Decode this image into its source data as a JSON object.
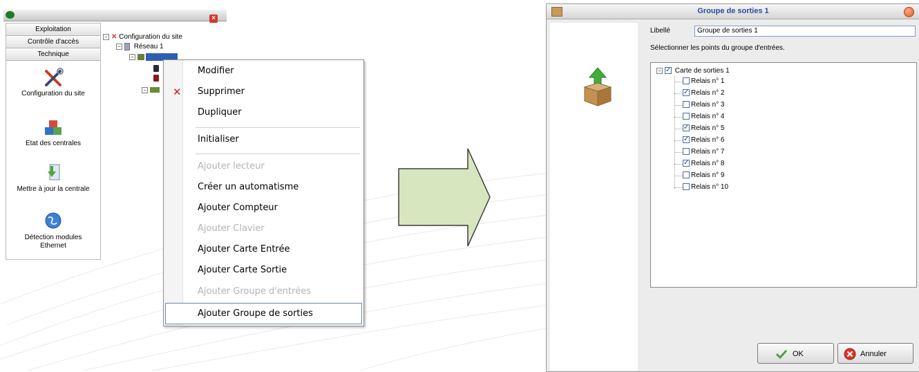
{
  "left_app": {
    "accordion": [
      "Exploitation",
      "Contrôle d'accès",
      "Technique"
    ],
    "sidebar_buttons": [
      {
        "label": "Configuration du site",
        "icon": "tools-icon"
      },
      {
        "label": "Etat des centrales",
        "icon": "blocks-icon"
      },
      {
        "label": "Mettre à jour la centrale",
        "icon": "update-icon"
      },
      {
        "label_line1": "Détection modules",
        "label_line2": "Ethernet",
        "icon": "globe-icon"
      }
    ],
    "tree": {
      "root": "Configuration du site",
      "network": "Réseau 1"
    }
  },
  "context_menu": {
    "items": [
      {
        "label": "Modifier",
        "enabled": true
      },
      {
        "label": "Supprimer",
        "enabled": true,
        "icon": "delete-icon"
      },
      {
        "label": "Dupliquer",
        "enabled": true
      },
      {
        "label": "Initialiser",
        "enabled": true
      },
      {
        "label": "Ajouter lecteur",
        "enabled": false
      },
      {
        "label": "Créer un automatisme",
        "enabled": true
      },
      {
        "label": "Ajouter Compteur",
        "enabled": true
      },
      {
        "label": "Ajouter Clavier",
        "enabled": false
      },
      {
        "label": "Ajouter Carte Entrée",
        "enabled": true
      },
      {
        "label": "Ajouter Carte Sortie",
        "enabled": true
      },
      {
        "label": "Ajouter Groupe d'entrées",
        "enabled": false
      },
      {
        "label": "Ajouter Groupe de sorties",
        "enabled": true,
        "highlighted": true
      }
    ]
  },
  "dialog": {
    "title": "Groupe de sorties 1",
    "libelle_label": "Libellé",
    "libelle_value": "Groupe de sorties 1",
    "instruction": "Sélectionner les points du groupe d'entrées.",
    "tree_root": {
      "label": "Carte de sorties 1",
      "checked": true
    },
    "relays": [
      {
        "label": "Relais n° 1",
        "checked": false
      },
      {
        "label": "Relais n° 2",
        "checked": true
      },
      {
        "label": "Relais n° 3",
        "checked": false
      },
      {
        "label": "Relais n° 4",
        "checked": false
      },
      {
        "label": "Relais n° 5",
        "checked": true
      },
      {
        "label": "Relais n° 6",
        "checked": true
      },
      {
        "label": "Relais n° 7",
        "checked": false
      },
      {
        "label": "Relais n° 8",
        "checked": true
      },
      {
        "label": "Relais n° 9",
        "checked": false
      },
      {
        "label": "Relais n° 10",
        "checked": false
      }
    ],
    "ok_label": "OK",
    "cancel_label": "Annuler"
  },
  "colors": {
    "arrow_fill": "#d8e6c0",
    "dialog_title": "#2a4b9b",
    "checkbox_check": "#21409a"
  }
}
